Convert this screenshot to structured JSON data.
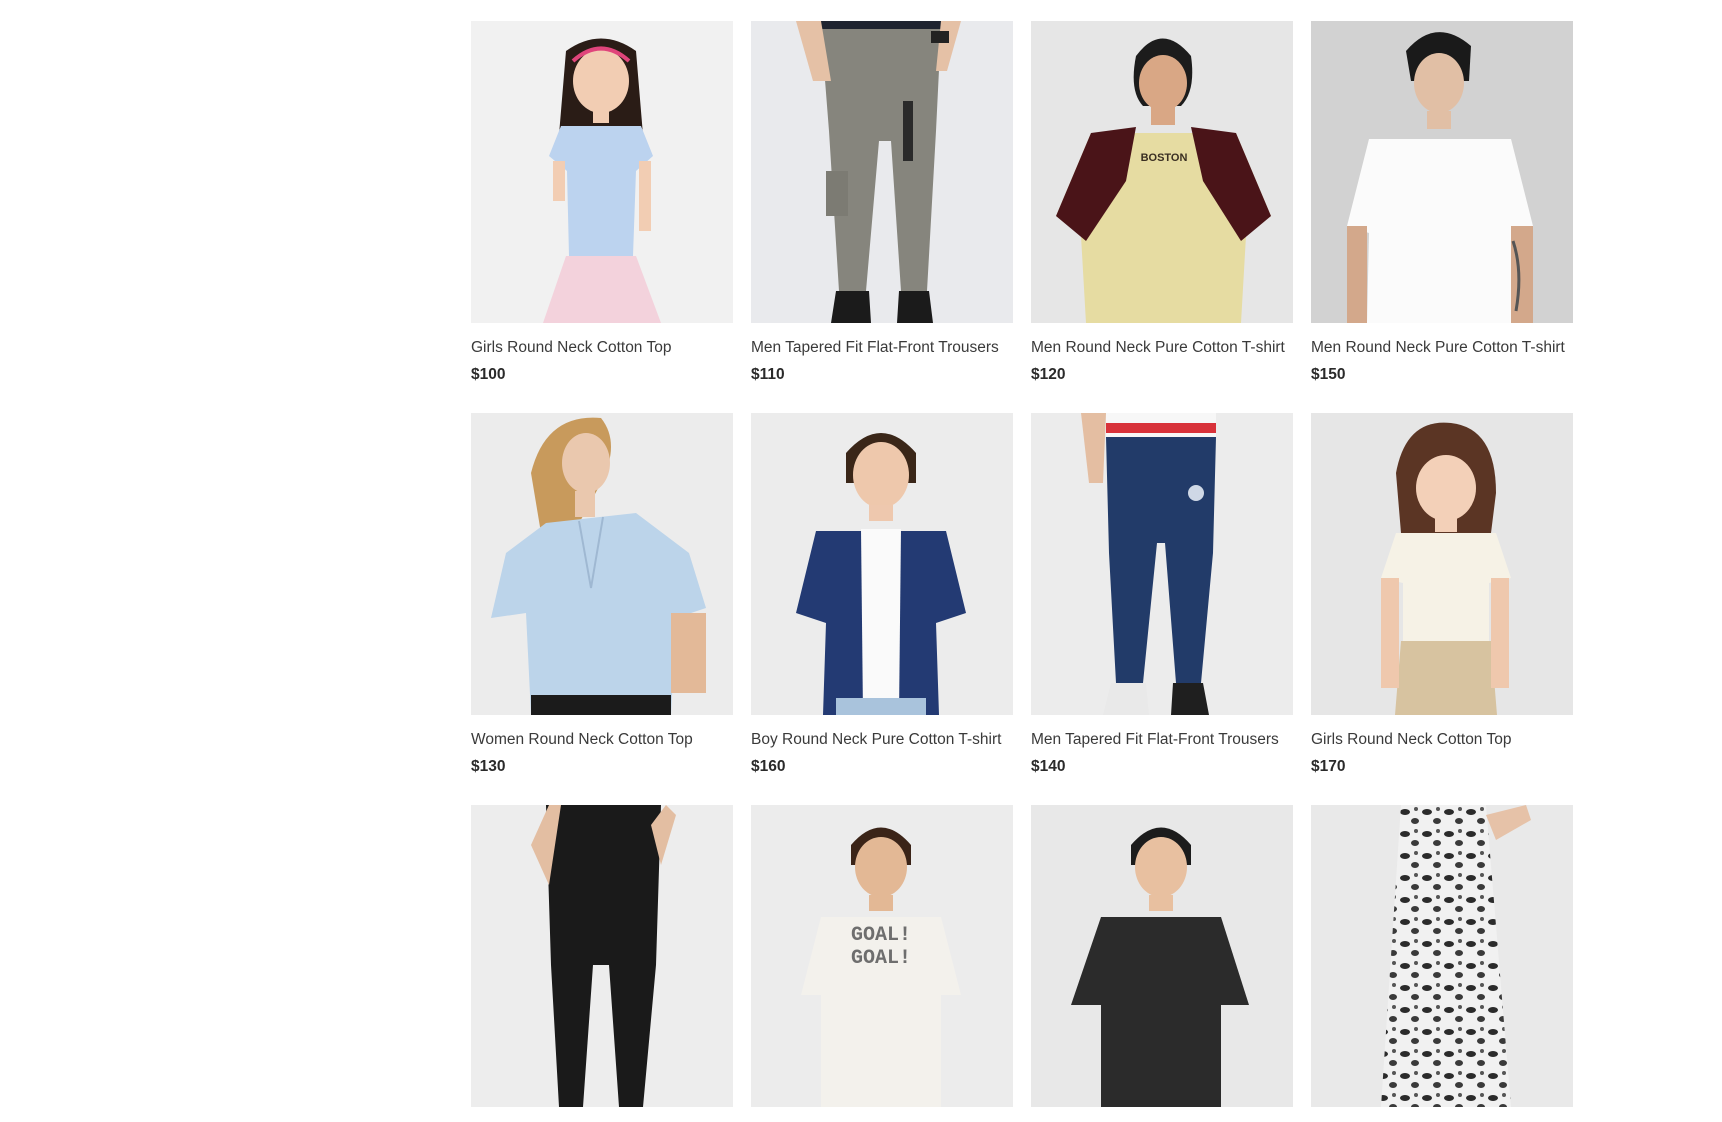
{
  "products": [
    {
      "name": "Girls Round Neck Cotton Top",
      "price": "$100"
    },
    {
      "name": "Men Tapered Fit Flat-Front Trousers",
      "price": "$110"
    },
    {
      "name": "Men Round Neck Pure Cotton T-shirt",
      "price": "$120"
    },
    {
      "name": "Men Round Neck Pure Cotton T-shirt",
      "price": "$150"
    },
    {
      "name": "Women Round Neck Cotton Top",
      "price": "$130"
    },
    {
      "name": "Boy Round Neck Pure Cotton T-shirt",
      "price": "$160"
    },
    {
      "name": "Men Tapered Fit Flat-Front Trousers",
      "price": "$140"
    },
    {
      "name": "Girls Round Neck Cotton Top",
      "price": "$170"
    },
    {
      "name": "",
      "price": ""
    },
    {
      "name": "",
      "price": ""
    },
    {
      "name": "",
      "price": ""
    },
    {
      "name": "",
      "price": ""
    }
  ],
  "shirt_prints": {
    "boston": "BOSTON",
    "goal": "GOAL!"
  }
}
